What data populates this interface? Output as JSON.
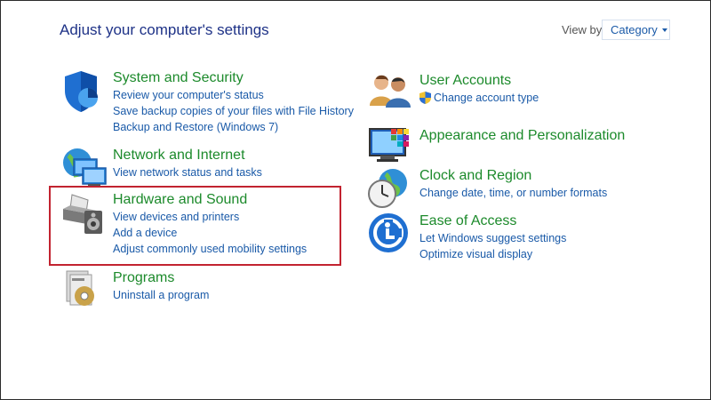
{
  "page": {
    "title": "Adjust your computer's settings",
    "view_by_label": "View by:",
    "view_by_value": "Category"
  },
  "left_column": [
    {
      "heading": "System and Security",
      "icon": "shield-icon",
      "links": [
        "Review your computer's status",
        "Save backup copies of your files with File History",
        "Backup and Restore (Windows 7)"
      ]
    },
    {
      "heading": "Network and Internet",
      "icon": "network-globe-icon",
      "links": [
        "View network status and tasks"
      ]
    },
    {
      "heading": "Hardware and Sound",
      "icon": "printer-speaker-icon",
      "links": [
        "View devices and printers",
        "Add a device",
        "Adjust commonly used mobility settings"
      ]
    },
    {
      "heading": "Programs",
      "icon": "programs-disc-icon",
      "links": [
        "Uninstall a program"
      ]
    }
  ],
  "right_column": [
    {
      "heading": "User Accounts",
      "icon": "users-icon",
      "links": [
        "Change account type"
      ]
    },
    {
      "heading": "Appearance and Personalization",
      "icon": "monitor-palette-icon",
      "links": []
    },
    {
      "heading": "Clock and Region",
      "icon": "clock-globe-icon",
      "links": [
        "Change date, time, or number formats"
      ]
    },
    {
      "heading": "Ease of Access",
      "icon": "ease-of-access-icon",
      "links": [
        "Let Windows suggest settings",
        "Optimize visual display"
      ]
    }
  ],
  "highlight": {
    "color": "#c22330",
    "target": "Hardware and Sound"
  },
  "colors": {
    "title": "#1e3287",
    "heading": "#1c8a2b",
    "link": "#1a5aa8"
  }
}
